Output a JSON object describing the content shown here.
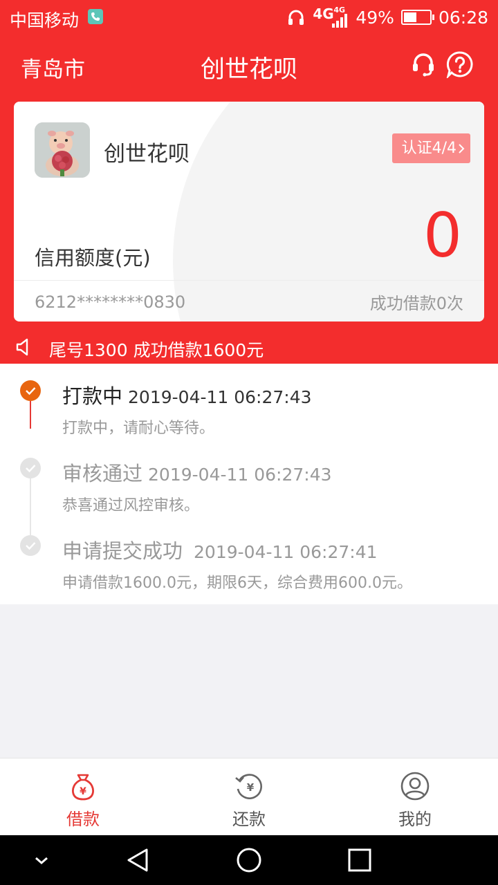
{
  "status_bar": {
    "carrier": "中国移动",
    "network_main": "4G",
    "network_secondary": "4G",
    "battery": "49%",
    "battery_level": 0.49,
    "time": "06:28"
  },
  "header": {
    "city": "青岛市",
    "title": "创世花呗"
  },
  "card": {
    "name": "创世花呗",
    "cert_badge": "认证4/4",
    "credit_label": "信用额度(元)",
    "credit_value": "0",
    "card_number": "6212********0830",
    "loan_count": "成功借款0次"
  },
  "notice": {
    "text": "尾号1300 成功借款1600元"
  },
  "timeline": [
    {
      "title": "打款中",
      "time": "2019-04-11 06:27:43",
      "desc": "打款中，请耐心等待。",
      "active": true
    },
    {
      "title": "审核通过",
      "time": "2019-04-11 06:27:43",
      "desc": "恭喜通过风控审核。",
      "active": false
    },
    {
      "title": "申请提交成功",
      "time": "2019-04-11 06:27:41",
      "desc": "申请借款1600.0元，期限6天，综合费用600.0元。",
      "active": false
    }
  ],
  "tabs": [
    {
      "label": "借款",
      "icon": "money-bag-icon",
      "active": true
    },
    {
      "label": "还款",
      "icon": "repay-cycle-icon",
      "active": false
    },
    {
      "label": "我的",
      "icon": "user-profile-icon",
      "active": false
    }
  ],
  "colors": {
    "brand_red": "#f32d2d",
    "active_orange": "#e8650f",
    "muted_text": "#999999"
  }
}
